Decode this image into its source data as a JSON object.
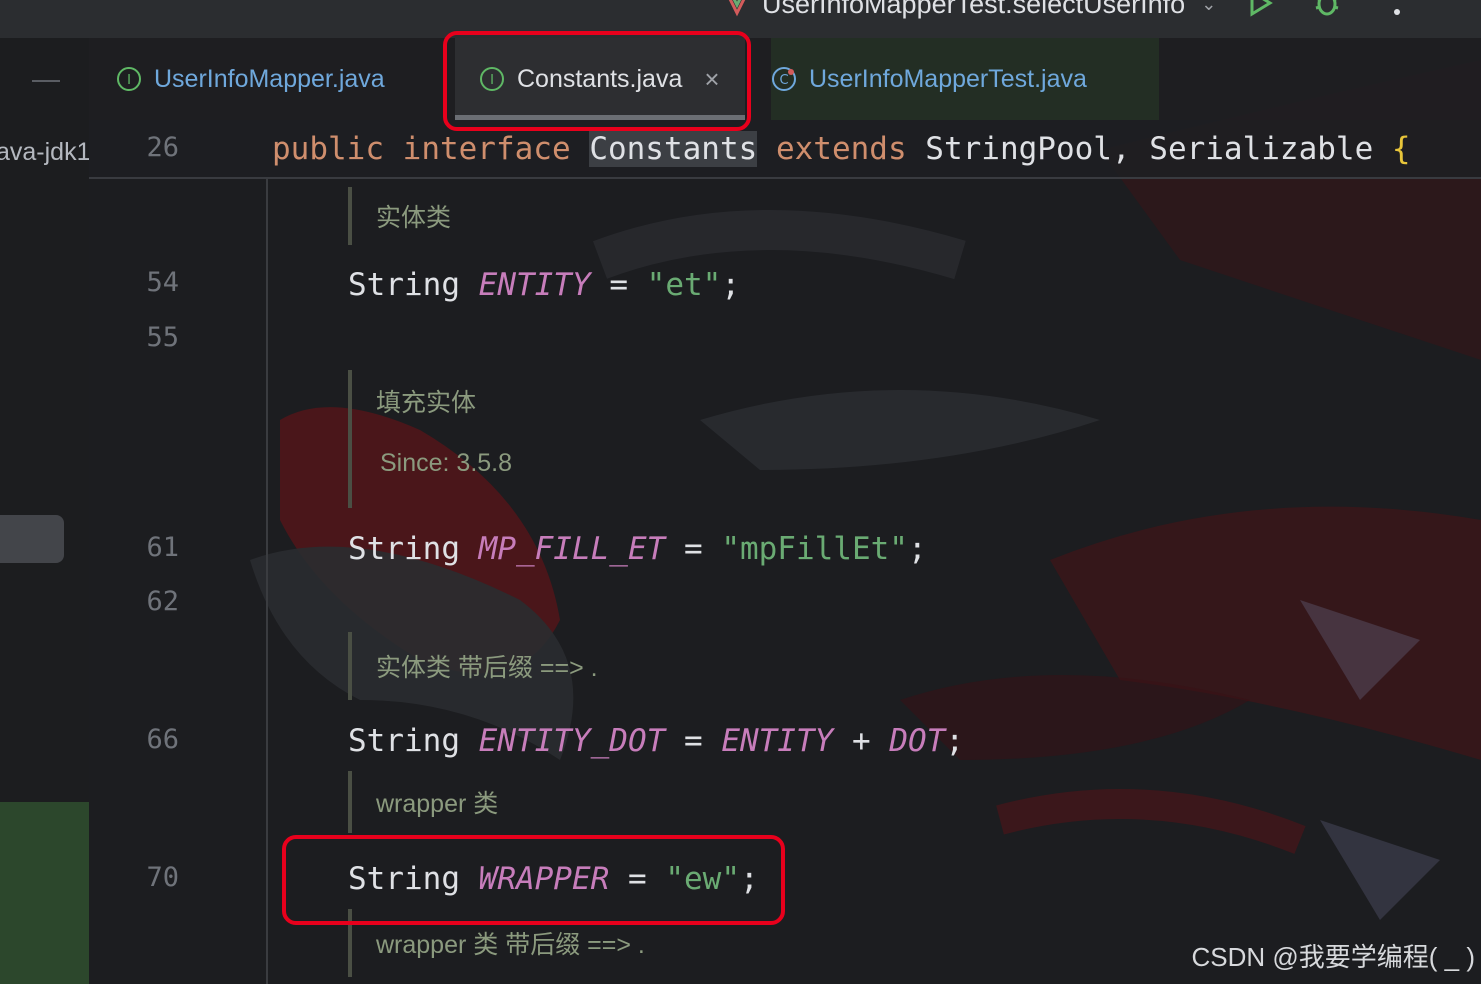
{
  "toolbar": {
    "run_config_label": "UserInfoMapperTest.selectUserInfo",
    "run_config_icon": "junit-config-icon",
    "run_icon": "run-icon",
    "debug_icon": "debug-icon",
    "more_icon": "more-vertical-icon"
  },
  "project_panel": {
    "collapse_icon": "minus-icon",
    "tree_item_text": "ava-jdk1"
  },
  "tabs": [
    {
      "label": "UserInfoMapper.java",
      "icon": "interface-icon",
      "active": false
    },
    {
      "label": "Constants.java",
      "icon": "interface-icon",
      "active": true,
      "close": "×"
    },
    {
      "label": "UserInfoMapperTest.java",
      "icon": "test-class-icon",
      "active": false
    }
  ],
  "sticky": {
    "line_number": "26",
    "kw_public": "public",
    "kw_interface": "interface",
    "name": "Constants",
    "kw_extends": "extends",
    "super1": "StringPool,",
    "super2": "Serializable",
    "brace": "{"
  },
  "code": {
    "doc1": "实体类",
    "l54_num": "54",
    "l54_type": "String",
    "l54_name": "ENTITY",
    "l54_eq": "=",
    "l54_value": "\"et\"",
    "l54_end": ";",
    "l55_num": "55",
    "doc2_line1": "填充实体",
    "doc2_line2": "Since: 3.5.8",
    "l61_num": "61",
    "l61_type": "String",
    "l61_name": "MP_FILL_ET",
    "l61_eq": "=",
    "l61_value": "\"mpFillEt\"",
    "l61_end": ";",
    "l62_num": "62",
    "doc3": "实体类 带后缀 ==> .",
    "l66_num": "66",
    "l66_type": "String",
    "l66_name": "ENTITY_DOT",
    "l66_eq": "=",
    "l66_ref1": "ENTITY",
    "l66_plus": "+",
    "l66_ref2": "DOT",
    "l66_end": ";",
    "doc4": "wrapper 类",
    "l70_num": "70",
    "l70_type": "String",
    "l70_name": "WRAPPER",
    "l70_eq": "=",
    "l70_value": "\"ew\"",
    "l70_end": ";",
    "doc5": "wrapper 类 带后缀 ==> ."
  },
  "watermark": "CSDN @我要学编程( _ )",
  "colors": {
    "highlight_box": "#e8001c",
    "keyword": "#cf8e6d",
    "constant": "#c77dbb",
    "string": "#6aab73",
    "doc_comment": "#8b9a7e",
    "tab_link": "#6fa8dc"
  }
}
